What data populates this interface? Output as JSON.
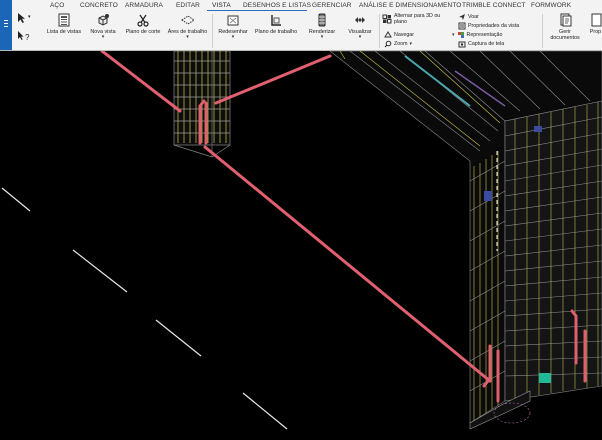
{
  "tabs": [
    {
      "label": "AÇO"
    },
    {
      "label": "CONCRETO"
    },
    {
      "label": "ARMADURA"
    },
    {
      "label": "EDITAR"
    },
    {
      "label": "VISTA"
    },
    {
      "label": "DESENHOS E LISTAS"
    },
    {
      "label": "GERENCIAR"
    },
    {
      "label": "ANÁLISE E DIMENSIONAMENTO"
    },
    {
      "label": "TRIMBLE CONNECT"
    },
    {
      "label": "FORMWORK"
    }
  ],
  "active_tab": "VISTA",
  "buttons": {
    "lista_de_vistas": "Lista de vistas",
    "nova_vista": "Nova vista",
    "plano_de_corte": "Plano de corte",
    "areas_de_trabalho": "Áres de trabalho",
    "redesenhar": "Redesenhar",
    "plano_de_trabalho": "Plano de trabalho",
    "renderizar": "Renderizar",
    "visualizar": "Visualizar",
    "alternar_3d_line1": "Alternar para 3D ou",
    "alternar_3d_line2": "plano",
    "navegar": "Navegar",
    "zoom": "Zoom",
    "voar": "Voar",
    "propriedades_da_vista": "Propriedades da vista",
    "representacao": "Representação",
    "captura_de_tela": "Captura de tela",
    "gerir_line1": "Gerir",
    "gerir_line2": "documentos",
    "propriedades_cut": "Prop"
  },
  "left_panel": {
    "select_glyph": "▸",
    "help_glyph": "?"
  },
  "colors": {
    "ribbon_bg": "#f3f3f3",
    "accent": "#1b66b7",
    "viewport_bg": "#000000",
    "rebar_red": "#e06070",
    "wire_yellow": "#d6d04a",
    "wire_grey": "#9a9a9a",
    "wire_cyan": "#4aa8b0"
  }
}
